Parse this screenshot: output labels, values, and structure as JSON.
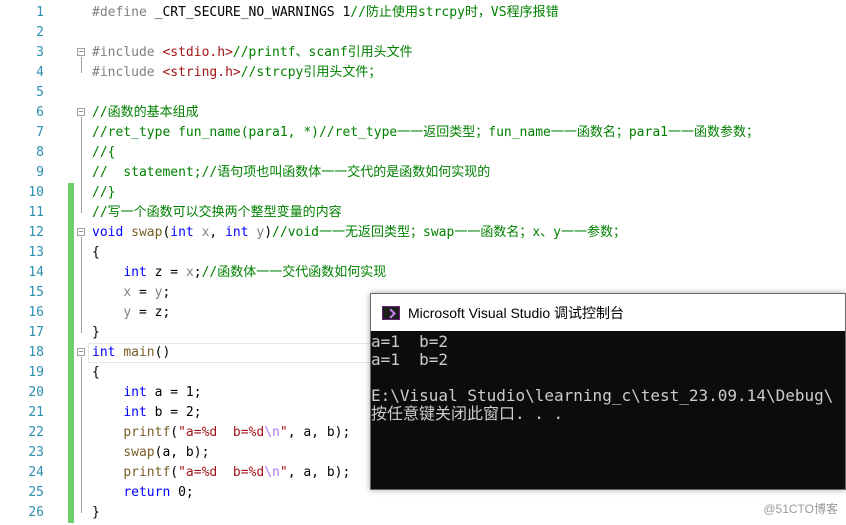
{
  "editor": {
    "lines": [
      {
        "n": "1",
        "parts": [
          [
            "pp",
            "#define "
          ],
          [
            "",
            "_CRT_SECURE_NO_WARNINGS 1"
          ],
          [
            "cm",
            "//防止使用strcpy时，VS程序报错"
          ]
        ]
      },
      {
        "n": "2",
        "parts": []
      },
      {
        "n": "3",
        "parts": [
          [
            "pp",
            "#include "
          ],
          [
            "inc",
            "<stdio.h>"
          ],
          [
            "cm",
            "//printf、scanf引用头文件"
          ]
        ]
      },
      {
        "n": "4",
        "parts": [
          [
            "pp",
            "#include "
          ],
          [
            "inc",
            "<string.h>"
          ],
          [
            "cm",
            "//strcpy引用头文件；"
          ]
        ]
      },
      {
        "n": "5",
        "parts": []
      },
      {
        "n": "6",
        "parts": [
          [
            "cm",
            "//函数的基本组成"
          ]
        ]
      },
      {
        "n": "7",
        "parts": [
          [
            "cm",
            "//ret_type fun_name(para1, *)//ret_type一一返回类型；fun_name一一函数名；para1一一函数参数；"
          ]
        ]
      },
      {
        "n": "8",
        "parts": [
          [
            "cm",
            "//{"
          ]
        ]
      },
      {
        "n": "9",
        "parts": [
          [
            "cm",
            "//  statement;//语句项也叫函数体一一交代的是函数如何实现的"
          ]
        ]
      },
      {
        "n": "10",
        "parts": [
          [
            "cm",
            "//}"
          ]
        ]
      },
      {
        "n": "11",
        "parts": [
          [
            "cm",
            "//写一个函数可以交换两个整型变量的内容"
          ]
        ]
      },
      {
        "n": "12",
        "parts": [
          [
            "kw",
            "void"
          ],
          [
            "",
            " "
          ],
          [
            "fn",
            "swap"
          ],
          [
            "",
            "("
          ],
          [
            "kw",
            "int"
          ],
          [
            "",
            " "
          ],
          [
            "param",
            "x"
          ],
          [
            "",
            ", "
          ],
          [
            "kw",
            "int"
          ],
          [
            "",
            " "
          ],
          [
            "param",
            "y"
          ],
          [
            "",
            ")"
          ],
          [
            "cm",
            "//void一一无返回类型；swap一一函数名；x、y一一参数；"
          ]
        ]
      },
      {
        "n": "13",
        "parts": [
          [
            "",
            "{"
          ]
        ]
      },
      {
        "n": "14",
        "parts": [
          [
            "",
            "    "
          ],
          [
            "kw",
            "int"
          ],
          [
            "",
            " z = "
          ],
          [
            "param",
            "x"
          ],
          [
            "",
            ";"
          ],
          [
            "cm",
            "//函数体一一交代函数如何实现"
          ]
        ]
      },
      {
        "n": "15",
        "parts": [
          [
            "",
            "    "
          ],
          [
            "param",
            "x"
          ],
          [
            "",
            " = "
          ],
          [
            "param",
            "y"
          ],
          [
            "",
            ";"
          ]
        ]
      },
      {
        "n": "16",
        "parts": [
          [
            "",
            "    "
          ],
          [
            "param",
            "y"
          ],
          [
            "",
            " = z;"
          ]
        ]
      },
      {
        "n": "17",
        "parts": [
          [
            "",
            "}"
          ]
        ]
      },
      {
        "n": "18",
        "parts": [
          [
            "kw",
            "int"
          ],
          [
            "",
            " "
          ],
          [
            "fn",
            "main"
          ],
          [
            "",
            "()"
          ]
        ]
      },
      {
        "n": "19",
        "parts": [
          [
            "",
            "{"
          ]
        ]
      },
      {
        "n": "20",
        "parts": [
          [
            "",
            "    "
          ],
          [
            "kw",
            "int"
          ],
          [
            "",
            " a = 1;"
          ]
        ]
      },
      {
        "n": "21",
        "parts": [
          [
            "",
            "    "
          ],
          [
            "kw",
            "int"
          ],
          [
            "",
            " b = 2;"
          ]
        ]
      },
      {
        "n": "22",
        "parts": [
          [
            "",
            "    "
          ],
          [
            "fn",
            "printf"
          ],
          [
            "",
            "("
          ],
          [
            "str",
            "\"a=%d  b=%d"
          ],
          [
            "esc",
            "\\n"
          ],
          [
            "str",
            "\""
          ],
          [
            "",
            ", a, b);"
          ]
        ]
      },
      {
        "n": "23",
        "parts": [
          [
            "",
            "    "
          ],
          [
            "fn",
            "swap"
          ],
          [
            "",
            "(a, b);"
          ]
        ]
      },
      {
        "n": "24",
        "parts": [
          [
            "",
            "    "
          ],
          [
            "fn",
            "printf"
          ],
          [
            "",
            "("
          ],
          [
            "str",
            "\"a=%d  b=%d"
          ],
          [
            "esc",
            "\\n"
          ],
          [
            "str",
            "\""
          ],
          [
            "",
            ", a, b);"
          ]
        ]
      },
      {
        "n": "25",
        "parts": [
          [
            "",
            "    "
          ],
          [
            "kw",
            "return"
          ],
          [
            "",
            " 0;"
          ]
        ]
      },
      {
        "n": "26",
        "parts": [
          [
            "",
            "}"
          ]
        ]
      }
    ]
  },
  "console": {
    "title": "Microsoft Visual Studio 调试控制台",
    "output": [
      "a=1  b=2",
      "a=1  b=2",
      "",
      "E:\\Visual Studio\\learning_c\\test_23.09.14\\Debug\\",
      "按任意键关闭此窗口. . ."
    ]
  },
  "watermark": "@51CTO博客"
}
